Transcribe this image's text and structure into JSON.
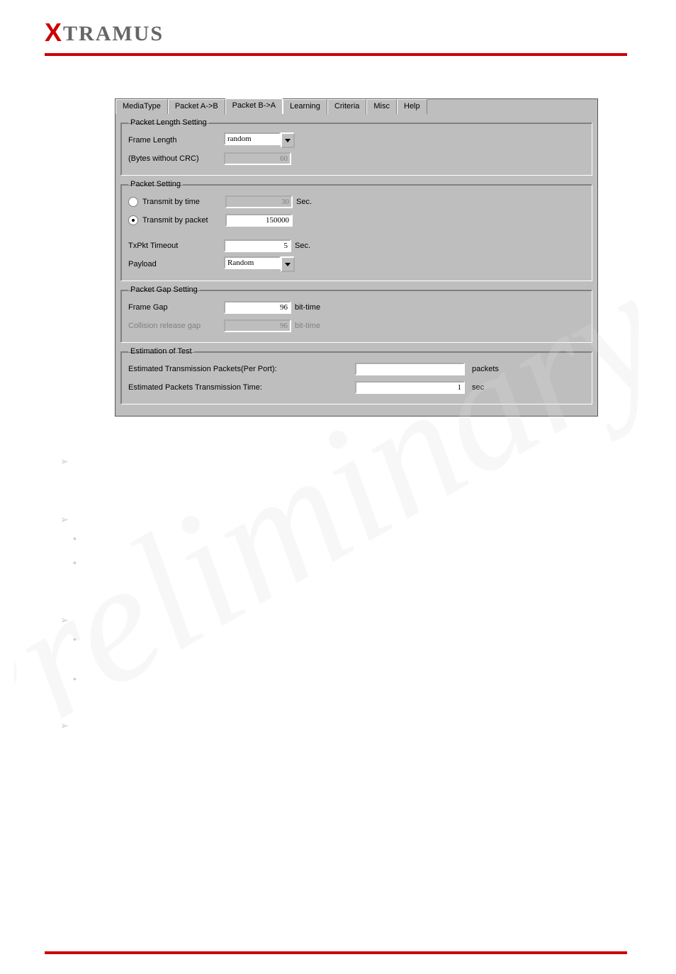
{
  "brand": {
    "x": "X",
    "rest": "TRAMUS"
  },
  "tabs": [
    "MediaType",
    "Packet A->B",
    "Packet B->A",
    "Learning",
    "Criteria",
    "Misc",
    "Help"
  ],
  "active_tab": 2,
  "g1": {
    "legend": "Packet Length Setting",
    "frame_len_lab": "Frame Length",
    "frame_len_val": "random",
    "bytes_lab": "(Bytes without CRC)",
    "bytes_val": "60"
  },
  "g2": {
    "legend": "Packet Setting",
    "r1_lab": "Transmit by time",
    "r1_val": "30",
    "r1_unit": "Sec.",
    "r2_lab": "Transmit by packet",
    "r2_val": "150000",
    "to_lab": "TxPkt Timeout",
    "to_val": "5",
    "to_unit": "Sec.",
    "pl_lab": "Payload",
    "pl_val": "Random"
  },
  "g3": {
    "legend": "Packet Gap Setting",
    "fg_lab": "Frame Gap",
    "fg_val": "96",
    "fg_unit": "bit-time",
    "cr_lab": "Collision release gap",
    "cr_val": "96",
    "cr_unit": "bit-time"
  },
  "g4": {
    "legend": "Estimation of Test",
    "r1_lab": "Estimated Transmission Packets(Per Port):",
    "r1_val": "",
    "r1_unit": "packets",
    "r2_lab": "Estimated Packets Transmission Time:",
    "r2_val": "1",
    "r2_unit": "sec"
  }
}
